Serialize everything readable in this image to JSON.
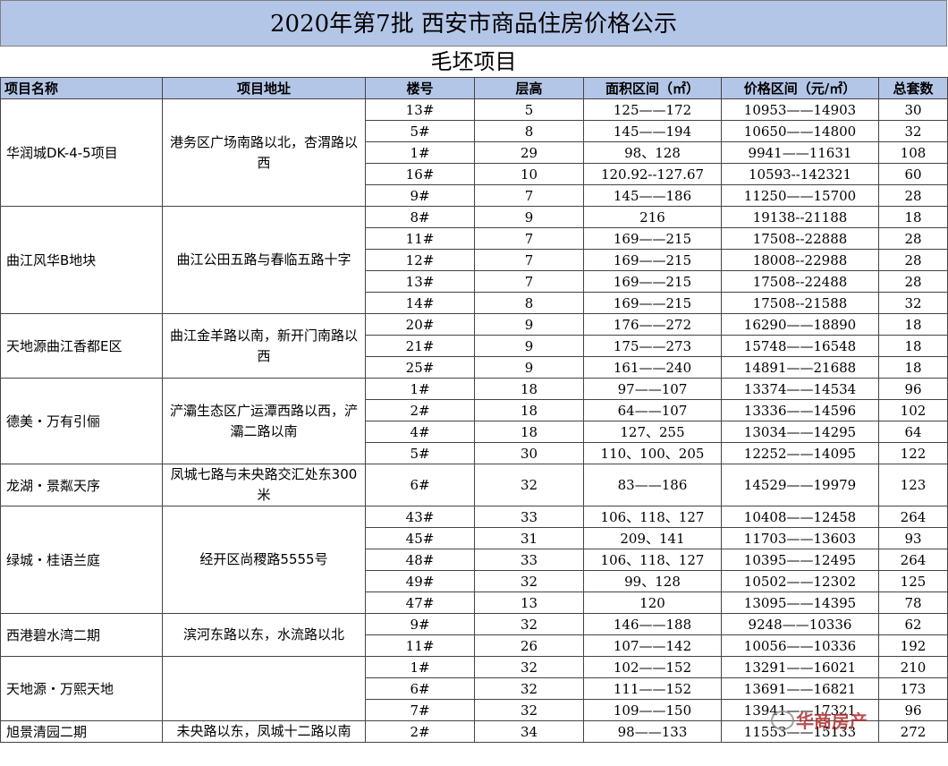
{
  "title": "2020年第7批 西安市商品住房价格公示",
  "subtitle": "毛坯项目",
  "headers": [
    "项目名称",
    "项目地址",
    "楼号",
    "层高",
    "面积区间（㎡）",
    "价格区间（元/㎡）",
    "总套数"
  ],
  "watermark": "华商房产",
  "projects": [
    {
      "name": "华润城DK-4-5项目",
      "address": "港务区广场南路以北，杏渭路以西",
      "rows": [
        [
          "13#",
          "5",
          "125——172",
          "10953——14903",
          "30"
        ],
        [
          "5#",
          "8",
          "145——194",
          "10650——14800",
          "32"
        ],
        [
          "1#",
          "29",
          "98、128",
          "9941——11631",
          "108"
        ],
        [
          "16#",
          "10",
          "120.92--127.67",
          "10593--142321",
          "60"
        ],
        [
          "9#",
          "7",
          "145——186",
          "11250——15700",
          "28"
        ]
      ]
    },
    {
      "name": "曲江风华B地块",
      "address": "曲江公田五路与春临五路十字",
      "rows": [
        [
          "8#",
          "9",
          "216",
          "19138--21188",
          "18"
        ],
        [
          "11#",
          "7",
          "169——215",
          "17508--22888",
          "28"
        ],
        [
          "12#",
          "7",
          "169——215",
          "18008--22988",
          "28"
        ],
        [
          "13#",
          "7",
          "169——215",
          "17508--22488",
          "28"
        ],
        [
          "14#",
          "8",
          "169——215",
          "17508--21588",
          "32"
        ]
      ]
    },
    {
      "name": "天地源曲江香都E区",
      "address": "曲江金羊路以南，新开门南路以西",
      "rows": [
        [
          "20#",
          "9",
          "176——272",
          "16290——18890",
          "18"
        ],
        [
          "21#",
          "9",
          "175——273",
          "15748——16548",
          "18"
        ],
        [
          "25#",
          "9",
          "161——240",
          "14891——21688",
          "18"
        ]
      ]
    },
    {
      "name": "德美・万有引俪",
      "address": "浐灞生态区广运潭西路以西，浐灞二路以南",
      "rows": [
        [
          "1#",
          "18",
          "97——107",
          "13374——14534",
          "96"
        ],
        [
          "2#",
          "18",
          "64——107",
          "13336——14596",
          "102"
        ],
        [
          "4#",
          "18",
          "127、255",
          "13034——14295",
          "64"
        ],
        [
          "5#",
          "30",
          "110、100、205",
          "12252——14095",
          "122"
        ]
      ]
    },
    {
      "name": "龙湖・景粼天序",
      "address": "凤城七路与未央路交汇处东300米",
      "rows": [
        [
          "6#",
          "32",
          "83——186",
          "14529——19979",
          "123"
        ]
      ]
    },
    {
      "name": "绿城・桂语兰庭",
      "address": "经开区尚稷路5555号",
      "rows": [
        [
          "43#",
          "33",
          "106、118、127",
          "10408——12458",
          "264"
        ],
        [
          "45#",
          "31",
          "209、141",
          "11703——13603",
          "93"
        ],
        [
          "48#",
          "33",
          "106、118、127",
          "10395——12495",
          "264"
        ],
        [
          "49#",
          "32",
          "99、128",
          "10502——12302",
          "125"
        ],
        [
          "47#",
          "13",
          "120",
          "13095——14395",
          "78"
        ]
      ]
    },
    {
      "name": "西港碧水湾二期",
      "address": "滨河东路以东，水流路以北",
      "rows": [
        [
          "9#",
          "32",
          "146——188",
          "9248——10336",
          "62"
        ],
        [
          "11#",
          "26",
          "107——142",
          "10056——10336",
          "192"
        ]
      ]
    },
    {
      "name": "天地源・万熙天地",
      "address": "",
      "rows": [
        [
          "1#",
          "32",
          "102——152",
          "13291——16021",
          "210"
        ],
        [
          "6#",
          "32",
          "111——152",
          "13691——16821",
          "173"
        ],
        [
          "7#",
          "32",
          "109——150",
          "13941——17321",
          "96"
        ]
      ]
    },
    {
      "name": "旭景清园二期",
      "address": "未央路以东，凤城十二路以南",
      "rows": [
        [
          "2#",
          "34",
          "98——133",
          "11553——15133",
          "272"
        ]
      ]
    }
  ]
}
